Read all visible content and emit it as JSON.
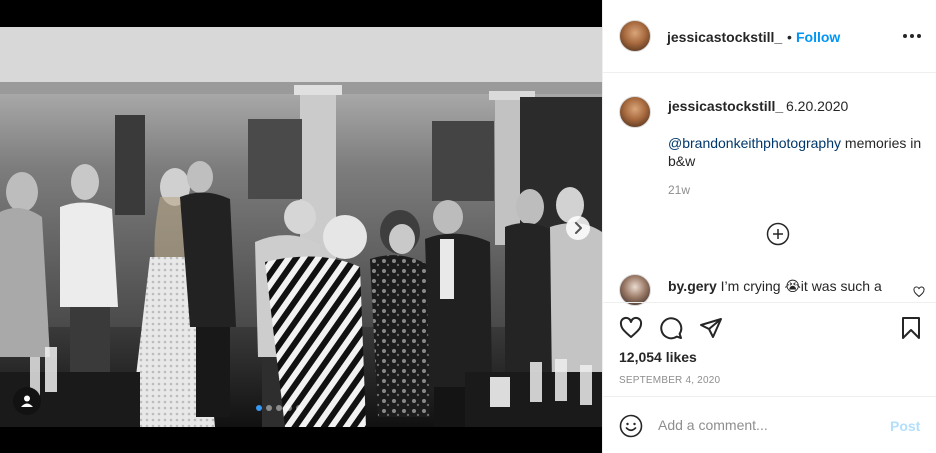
{
  "post": {
    "author": "jessicastockstill_",
    "follow_label": "Follow",
    "separator": "•"
  },
  "media": {
    "slide_count": 5,
    "active_slide": 1,
    "next_icon": "chevron-right-icon",
    "tag_icon": "user-tag-icon"
  },
  "caption": {
    "username": "jessicastockstill_",
    "date_text": "6.20.2020",
    "mention": "@brandonkeithphotography",
    "text": " memories in b&w",
    "time_ago": "21w"
  },
  "comments": [
    {
      "username": "by.gery",
      "text": " I’m crying 😭it was such a"
    }
  ],
  "actions": {
    "likes": "12,054 likes",
    "date": "SEPTEMBER 4, 2020"
  },
  "add_comment": {
    "placeholder": "Add a comment...",
    "post_label": "Post"
  },
  "colors": {
    "link": "#0095f6",
    "mention": "#00376b",
    "post_disabled": "#b2dffc",
    "carousel_active_dot": "#3897f0"
  }
}
